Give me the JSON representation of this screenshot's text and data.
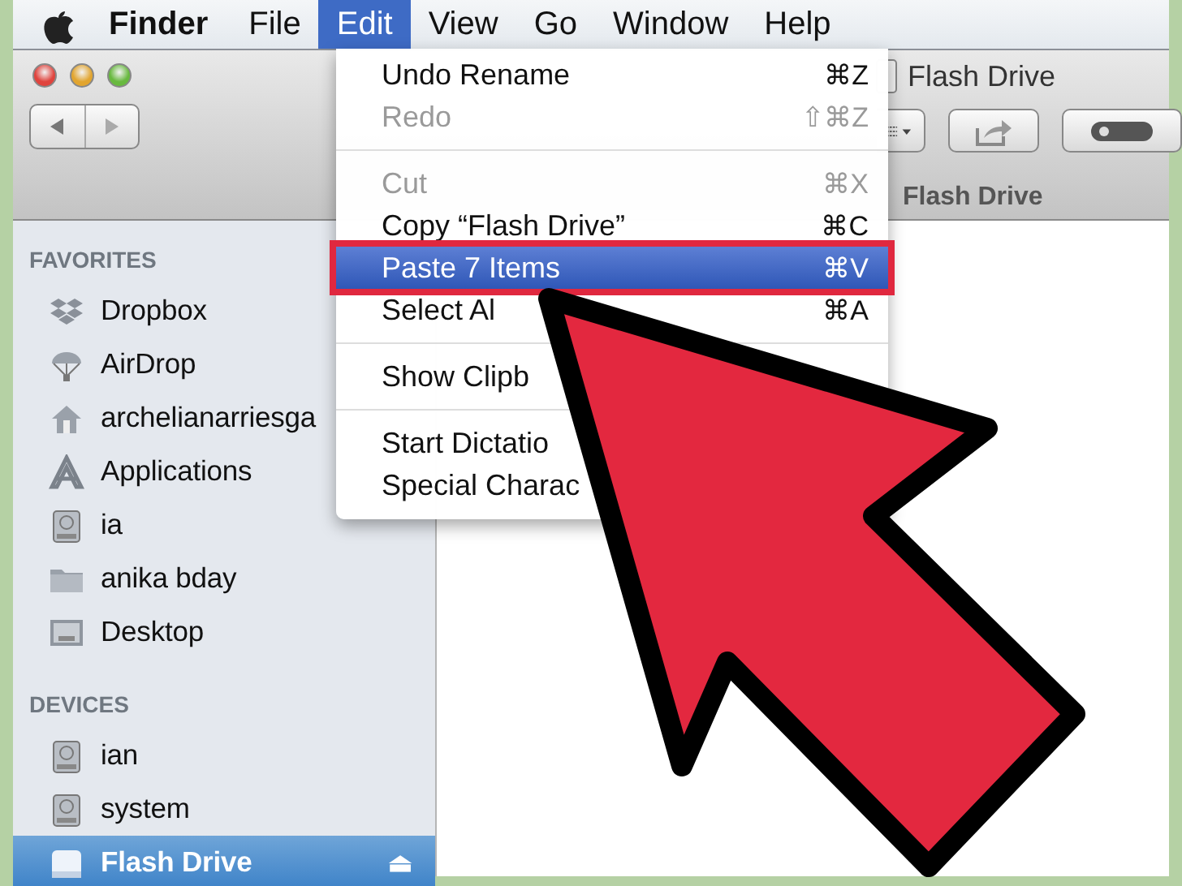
{
  "menu_bar": [
    {
      "label": "Finder",
      "selected": false,
      "kind": "app"
    },
    {
      "label": "File",
      "selected": false,
      "kind": "menu"
    },
    {
      "label": "Edit",
      "selected": true,
      "kind": "menu"
    },
    {
      "label": "View",
      "selected": false,
      "kind": "menu"
    },
    {
      "label": "Go",
      "selected": false,
      "kind": "menu"
    },
    {
      "label": "Window",
      "selected": false,
      "kind": "menu"
    },
    {
      "label": "Help",
      "selected": false,
      "kind": "menu"
    }
  ],
  "window": {
    "title": "Flash Drive",
    "path_bar": "Flash Drive"
  },
  "sidebar": [
    {
      "heading": "FAVORITES",
      "items": [
        {
          "label": "Dropbox",
          "kind": "dropbox",
          "selected": false
        },
        {
          "label": "AirDrop",
          "kind": "airdrop",
          "selected": false
        },
        {
          "label": "archelianarriesga",
          "kind": "home",
          "selected": false
        },
        {
          "label": "Applications",
          "kind": "apps",
          "selected": false
        },
        {
          "label": "ia",
          "kind": "disk",
          "selected": false
        },
        {
          "label": "anika bday",
          "kind": "folder",
          "selected": false
        },
        {
          "label": "Desktop",
          "kind": "desktop",
          "selected": false
        }
      ]
    },
    {
      "heading": "DEVICES",
      "items": [
        {
          "label": "ian",
          "kind": "disk",
          "selected": false
        },
        {
          "label": "system",
          "kind": "disk",
          "selected": false
        },
        {
          "label": "Flash Drive",
          "kind": "drive",
          "selected": true,
          "eject": "⏏"
        }
      ]
    }
  ],
  "edit_menu": [
    {
      "kind": "item",
      "label": "Undo Rename",
      "shortcut": "⌘Z",
      "disabled": false,
      "selected": false
    },
    {
      "kind": "item",
      "label": "Redo",
      "shortcut": "⇧⌘Z",
      "disabled": true,
      "selected": false
    },
    {
      "kind": "separator"
    },
    {
      "kind": "item",
      "label": "Cut",
      "shortcut": "⌘X",
      "disabled": true,
      "selected": false
    },
    {
      "kind": "item",
      "label": "Copy “Flash Drive”",
      "shortcut": "⌘C",
      "disabled": false,
      "selected": false
    },
    {
      "kind": "item",
      "label": "Paste 7 Items",
      "shortcut": "⌘V",
      "disabled": false,
      "selected": true
    },
    {
      "kind": "item",
      "label": "Select Al",
      "shortcut": "⌘A",
      "disabled": false,
      "selected": false
    },
    {
      "kind": "separator"
    },
    {
      "kind": "item",
      "label": "Show Clipb",
      "disabled": false,
      "selected": false
    },
    {
      "kind": "separator"
    },
    {
      "kind": "item",
      "label": "Start Dictatio",
      "disabled": false,
      "selected": false
    },
    {
      "kind": "item",
      "label": "Special Charac",
      "disabled": false,
      "selected": false
    }
  ]
}
